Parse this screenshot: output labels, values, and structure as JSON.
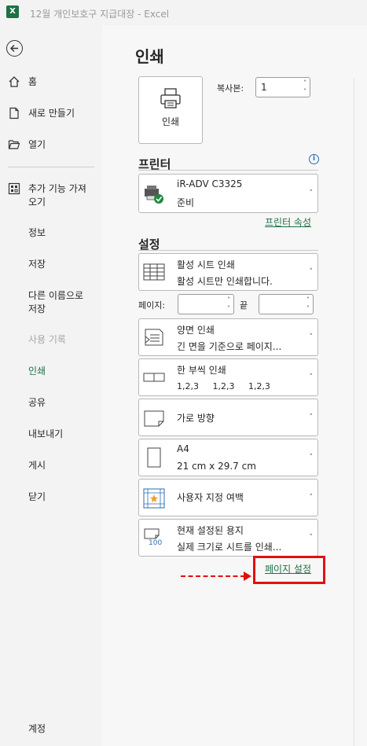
{
  "window": {
    "app_icon_letter": "X",
    "title": "12월 개인보호구 지급대장  -  Excel"
  },
  "sidebar": {
    "items": [
      {
        "label": "홈",
        "icon": "home-icon"
      },
      {
        "label": "새로 만들기",
        "icon": "new-document-icon"
      },
      {
        "label": "열기",
        "icon": "open-folder-icon"
      },
      {
        "label": "추가 기능 가져오기",
        "icon": "add-ins-icon"
      },
      {
        "label": "정보"
      },
      {
        "label": "저장"
      },
      {
        "label": "다른 이름으로 저장"
      },
      {
        "label": "사용 기록",
        "state": "disabled"
      },
      {
        "label": "인쇄",
        "state": "active"
      },
      {
        "label": "공유"
      },
      {
        "label": "내보내기"
      },
      {
        "label": "게시"
      },
      {
        "label": "닫기"
      }
    ],
    "footer": "계정"
  },
  "main": {
    "title": "인쇄",
    "print_button": "인쇄",
    "copies_label": "복사본:",
    "copies_value": "1",
    "printer_section": "프린터",
    "printer": {
      "name": "iR-ADV C3325",
      "status": "준비"
    },
    "printer_properties_link": "프린터 속성",
    "settings_section": "설정",
    "settings": [
      {
        "title": "활성 시트 인쇄",
        "desc": "활성 시트만 인쇄합니다.",
        "icon": "sheet-grid-icon"
      },
      {
        "title": "양면 인쇄",
        "desc": "긴 면을 기준으로 페이지...",
        "icon": "duplex-icon"
      },
      {
        "title": "한 부씩 인쇄",
        "desc": "1,2,3     1,2,3     1,2,3",
        "icon": "collate-icon"
      },
      {
        "title": "가로 방향",
        "desc": "",
        "icon": "landscape-icon"
      },
      {
        "title": "A4",
        "desc": "21 cm x 29.7 cm",
        "icon": "paper-size-icon"
      },
      {
        "title": "사용자 지정 여백",
        "desc": "",
        "icon": "margins-icon"
      },
      {
        "title": "현재 설정된 용지",
        "desc": "실제 크기로 시트를 인쇄...",
        "icon": "scaling-icon",
        "icon_text": "100"
      }
    ],
    "pages_label": "페이지:",
    "pages_from": "",
    "pages_to_label": "끝",
    "pages_to": "",
    "page_setup_link": "페이지 설정"
  },
  "colors": {
    "accent": "#1e7145",
    "highlight": "#e31010",
    "info": "#2b6cb0"
  }
}
